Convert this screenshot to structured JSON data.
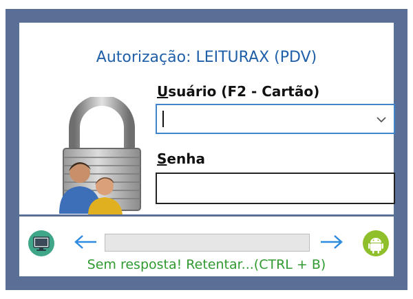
{
  "dialog": {
    "title": "Autorização: LEITURAX (PDV)"
  },
  "user_field": {
    "label_accel": "U",
    "label_rest": "suário (F2 - Cartão)",
    "value": ""
  },
  "password_field": {
    "label_accel": "S",
    "label_rest": "enha",
    "value": ""
  },
  "connection": {
    "left_icon": "computer-icon",
    "right_icon": "android-icon",
    "progress": 0,
    "status_text": "Sem resposta! Retentar...(CTRL + B)"
  },
  "colors": {
    "frame": "#5a6f96",
    "title": "#1f5fa8",
    "arrows": "#2e8be0",
    "status": "#2f9a2f",
    "focus_border": "#3f83cc"
  }
}
